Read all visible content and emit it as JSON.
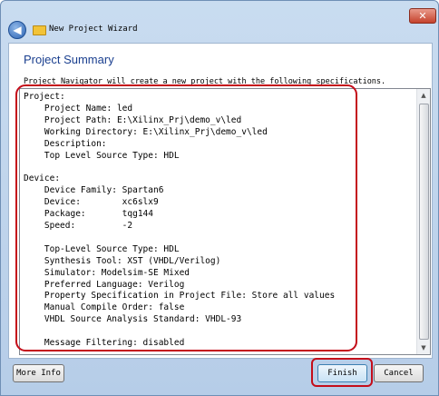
{
  "window": {
    "title": "New Project Wizard",
    "close_label": "✕",
    "back_label": "◀"
  },
  "page": {
    "heading": "Project Summary",
    "subtitle": "Project Navigator will create a new project with the following specifications."
  },
  "summary_lines": [
    "Project:",
    "    Project Name: led",
    "    Project Path: E:\\Xilinx_Prj\\demo_v\\led",
    "    Working Directory: E:\\Xilinx_Prj\\demo_v\\led",
    "    Description:",
    "    Top Level Source Type: HDL",
    "",
    "Device:",
    "    Device Family: Spartan6",
    "    Device:        xc6slx9",
    "    Package:       tqg144",
    "    Speed:         -2",
    "",
    "    Top-Level Source Type: HDL",
    "    Synthesis Tool: XST (VHDL/Verilog)",
    "    Simulator: Modelsim-SE Mixed",
    "    Preferred Language: Verilog",
    "    Property Specification in Project File: Store all values",
    "    Manual Compile Order: false",
    "    VHDL Source Analysis Standard: VHDL-93",
    "",
    "    Message Filtering: disabled"
  ],
  "buttons": {
    "more_info": "More Info",
    "finish": "Finish",
    "cancel": "Cancel"
  },
  "colors": {
    "heading": "#1a3f8f",
    "annotation": "#c40d1a"
  }
}
